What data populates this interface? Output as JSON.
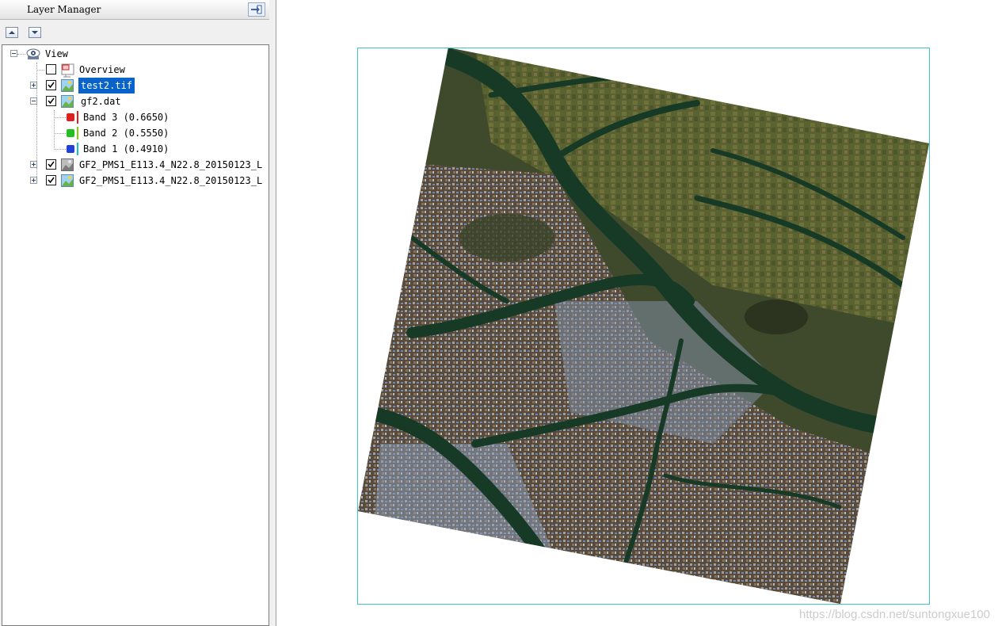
{
  "panel": {
    "title": "Layer Manager",
    "toolbar": {
      "up_icon": "arrow-up-icon",
      "down_icon": "arrow-down-icon"
    }
  },
  "tree": {
    "root": {
      "label": "View",
      "icon": "eye-icon"
    },
    "overview": {
      "label": "Overview",
      "checked": false
    },
    "layers": [
      {
        "label": "test2.tif",
        "checked": true,
        "expanded": false,
        "selected": true
      },
      {
        "label": "gf2.dat",
        "checked": true,
        "expanded": true,
        "bands": [
          {
            "label": "Band 3 (0.6650)",
            "color": "#e02020"
          },
          {
            "label": "Band 2 (0.5550)",
            "color": "#22c022"
          },
          {
            "label": "Band 1 (0.4910)",
            "color": "#2040d8"
          }
        ]
      },
      {
        "label": "GF2_PMS1_E113.4_N22.8_20150123_L",
        "checked": true,
        "expanded": false
      },
      {
        "label": "GF2_PMS1_E113.4_N22.8_20150123_L",
        "checked": true,
        "expanded": false
      }
    ]
  },
  "map": {
    "frame_color": "#41c5c2"
  },
  "watermark": "https://blog.csdn.net/suntongxue100"
}
